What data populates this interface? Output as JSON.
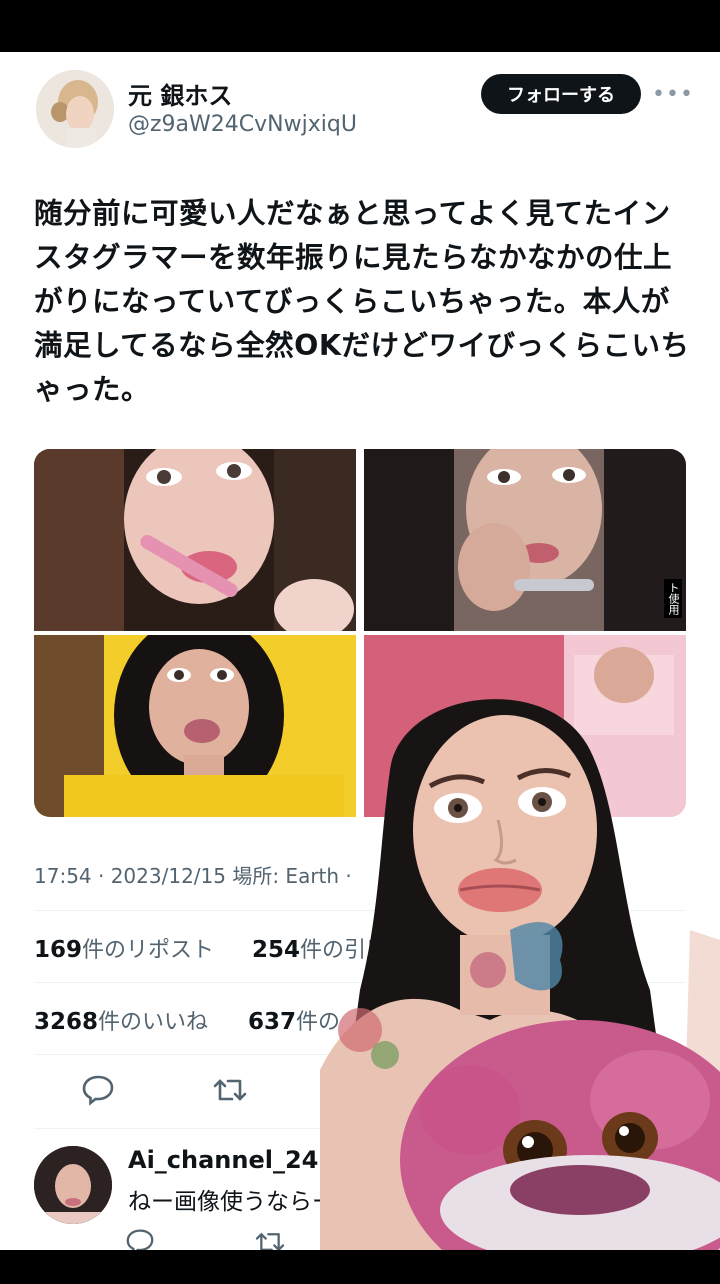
{
  "tweet": {
    "author_name": "元 銀ホス",
    "author_handle": "@z9aW24CvNwjxiqU",
    "follow_label": "フォローする",
    "more_icon": "more-dots-icon",
    "text": "随分前に可愛い人だなぁと思ってよく見てたインスタグラマーを数年振りに見たらなかなかの仕上がりになっていてびっくらこいちゃった。本人が満足してるなら全然OKだけどワイびっくらこいちゃった。",
    "meta": "17:54 · 2023/12/15 場所: Earth ·",
    "image_label": "ト使用",
    "stats": {
      "reposts_count": "169",
      "reposts_label": "件のリポスト",
      "quotes_count": "254",
      "quotes_label": "件の引用",
      "likes_count": "3268",
      "likes_label": "件のいいね",
      "bookmarks_count": "637",
      "bookmarks_label": "件の"
    }
  },
  "reply": {
    "author_name": "Ai_channel_24",
    "text": "ねー画像使うならー言"
  },
  "colors": {
    "text_primary": "#0f1419",
    "text_secondary": "#536471",
    "follow_bg": "#0f1419",
    "card_bg": "#ffffff",
    "frame_bg": "#000000"
  }
}
